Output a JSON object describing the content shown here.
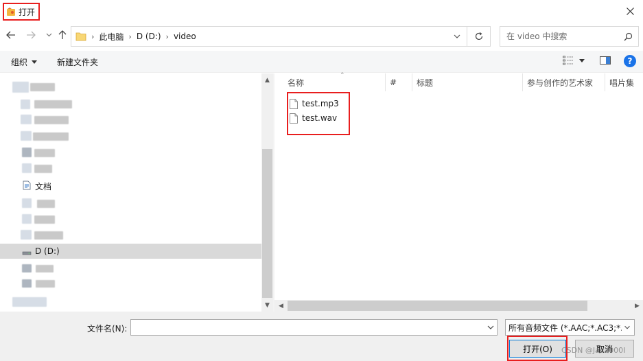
{
  "window": {
    "title": "打开"
  },
  "address": {
    "crumbs": [
      "此电脑",
      "D (D:)",
      "video"
    ]
  },
  "search": {
    "placeholder": "在 video 中搜索"
  },
  "toolbar": {
    "organize": "组织",
    "new_folder": "新建文件夹"
  },
  "nav": {
    "items": [
      {
        "label": "文档",
        "icon": "document-icon"
      },
      {
        "label": "D (D:)",
        "icon": "drive-icon",
        "selected": true
      }
    ]
  },
  "columns": [
    "名称",
    "#",
    "标题",
    "参与创作的艺术家",
    "唱片集"
  ],
  "files": [
    "test.mp3",
    "test.wav"
  ],
  "bottom": {
    "filename_label": "文件名(N):",
    "filename_value": "",
    "filetype": "所有音频文件 (*.AAC;*.AC3;*.A",
    "open_button": "打开(O)",
    "cancel_button": "取消"
  },
  "watermark": "CSDN @Java000I",
  "colors": {
    "highlight_border": "#e81e1e",
    "selected_row": "#d9d9d9",
    "help_blue": "#1a73e8"
  }
}
